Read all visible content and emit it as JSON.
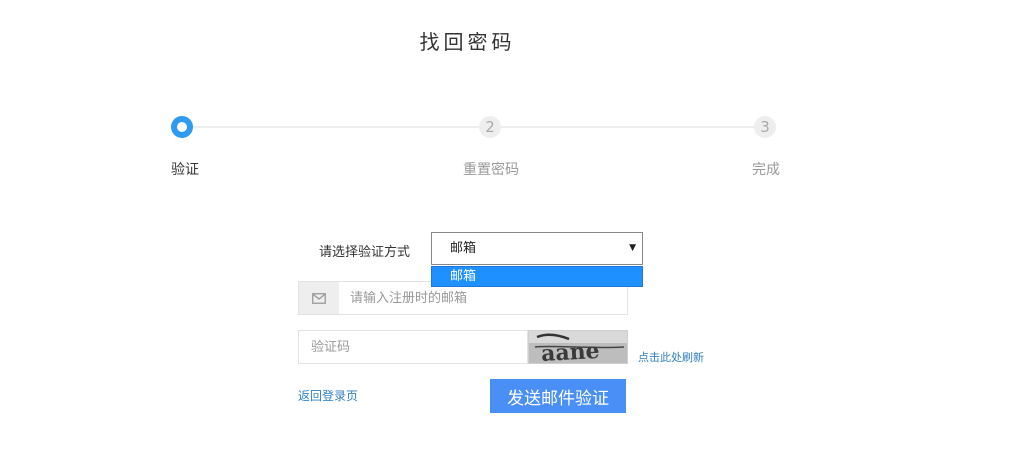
{
  "page": {
    "title": "找回密码"
  },
  "steps": [
    {
      "number": "",
      "label": "验证",
      "state": "active"
    },
    {
      "number": "2",
      "label": "重置密码",
      "state": "todo"
    },
    {
      "number": "3",
      "label": "完成",
      "state": "todo"
    }
  ],
  "form": {
    "method_label": "请选择验证方式",
    "method_select": {
      "selected": "邮箱",
      "options": [
        "邮箱"
      ]
    },
    "email": {
      "icon": "envelope-icon",
      "value": "",
      "placeholder": "请输入注册时的邮箱"
    },
    "captcha": {
      "value": "",
      "placeholder": "验证码",
      "refresh_label": "点击此处刷新"
    },
    "back_link": "返回登录页",
    "send_button": "发送邮件验证"
  },
  "colors": {
    "accent": "#2d9cf0",
    "button": "#4a8ff5",
    "link": "#2f7fc1",
    "dropdown_highlight": "#1e90ff"
  }
}
